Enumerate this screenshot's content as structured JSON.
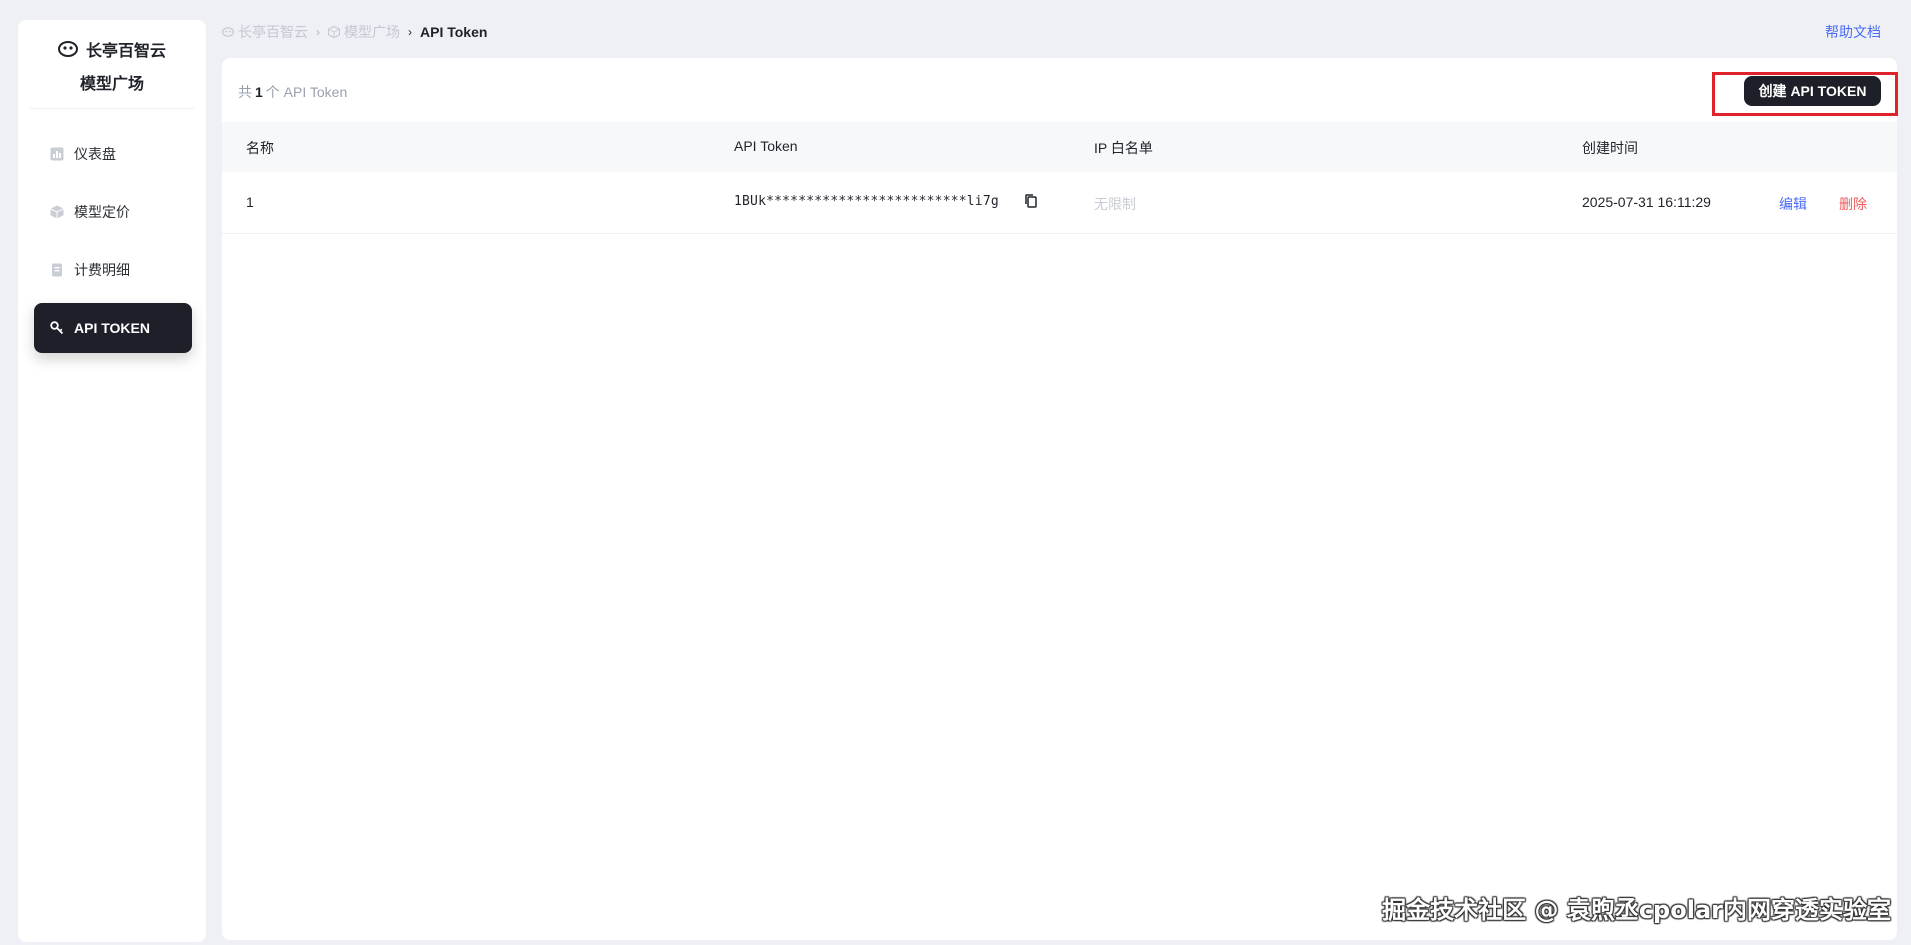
{
  "sidebar": {
    "brand_name": "长亭百智云",
    "brand_sub": "模型广场",
    "items": [
      {
        "label": "仪表盘",
        "icon": "dashboard-icon",
        "active": false
      },
      {
        "label": "模型定价",
        "icon": "cube-icon",
        "active": false
      },
      {
        "label": "计费明细",
        "icon": "receipt-icon",
        "active": false
      },
      {
        "label": "API TOKEN",
        "icon": "key-icon",
        "active": true
      }
    ]
  },
  "breadcrumb": {
    "items": [
      {
        "label": "长亭百智云",
        "icon": "logo-icon"
      },
      {
        "label": "模型广场",
        "icon": "cube-icon"
      },
      {
        "label": "API Token",
        "icon": ""
      }
    ]
  },
  "header": {
    "help_label": "帮助文档"
  },
  "main": {
    "count_prefix": "共",
    "count_value": "1",
    "count_suffix": "个 API Token",
    "create_button_label": "创建 API TOKEN",
    "columns": [
      "名称",
      "API Token",
      "IP 白名单",
      "创建时间"
    ],
    "rows": [
      {
        "name": "1",
        "token": "1BUk*************************li7g",
        "ip_whitelist": "无限制",
        "created_at": "2025-07-31 16:11:29",
        "edit_label": "编辑",
        "delete_label": "删除"
      }
    ]
  },
  "watermark": "掘金技术社区 @ 袁煦丞cpolar内网穿透实验室",
  "colors": {
    "accent": "#4a6cf7",
    "danger": "#f05b5b",
    "dark": "#1e2029",
    "highlight": "#e0232a"
  }
}
